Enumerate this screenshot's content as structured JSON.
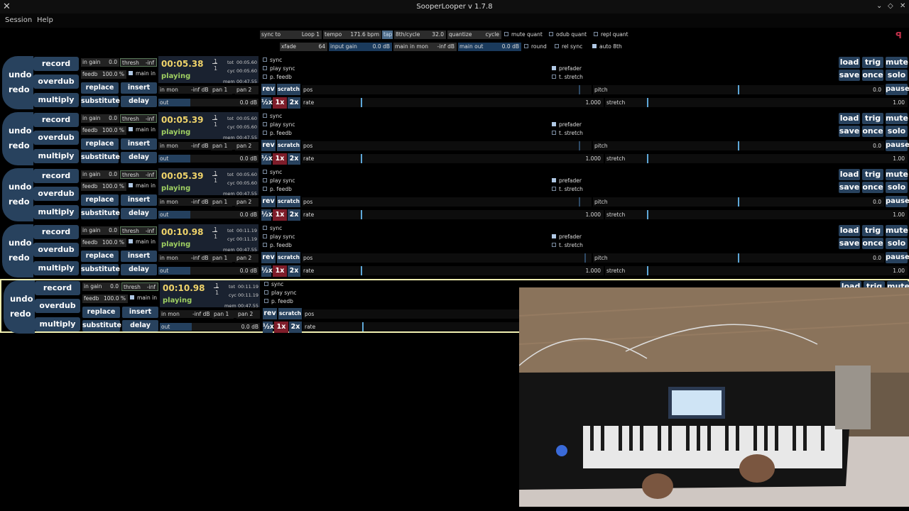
{
  "window": {
    "title": "SooperLooper v 1.7.8"
  },
  "menu": {
    "session": "Session",
    "help": "Help"
  },
  "globals": {
    "sync_to_label": "sync to",
    "sync_to_value": "Loop 1",
    "tempo_label": "tempo",
    "tempo_value": "171.6 bpm",
    "tap": "tap",
    "eighth_label": "8th/cycle",
    "eighth_value": "32.0",
    "quantize_label": "quantize",
    "quantize_value": "cycle",
    "mute_quant": "mute quant",
    "odub_quant": "odub quant",
    "repl_quant": "repl quant",
    "xfade_label": "xfade",
    "xfade_value": "64",
    "input_gain_label": "input gain",
    "input_gain_value": "0.0 dB",
    "main_in_mon_label": "main in mon",
    "main_in_mon_value": "-inf dB",
    "main_out_label": "main out",
    "main_out_value": "0.0 dB",
    "round": "round",
    "rel_sync": "rel sync",
    "auto_8th": "auto 8th"
  },
  "labels": {
    "undo": "undo",
    "redo": "redo",
    "record": "record",
    "overdub": "overdub",
    "multiply": "multiply",
    "replace": "replace",
    "insert": "insert",
    "substitute": "substitute",
    "delay": "delay",
    "in_gain": "in gain",
    "thresh": "thresh",
    "feedb": "feedb",
    "main_in": "main in",
    "in_mon": "in mon",
    "pan1": "pan 1",
    "pan2": "pan 2",
    "out": "out",
    "tot": "tot",
    "cyc": "cyc",
    "mem": "mem",
    "sync": "sync",
    "play_sync": "play sync",
    "p_feedb": "p. feedb",
    "prefader": "prefader",
    "t_stretch": "t. stretch",
    "rev": "rev",
    "scratch": "scratch",
    "pos": "pos",
    "rate": "rate",
    "half": "½x",
    "x1": "1x",
    "x2": "2x",
    "pitch": "pitch",
    "stretch": "stretch",
    "load": "load",
    "trig": "trig",
    "mute": "mute",
    "save": "save",
    "once": "once",
    "solo": "solo",
    "pause": "pause"
  },
  "loops": [
    {
      "time": "00:05.38",
      "state": "playing",
      "in_gain": "0.0",
      "thresh": "-inf",
      "feedb": "100.0 %",
      "in_mon": "-inf dB",
      "out": "0.0 dB",
      "tot": "00:05.60",
      "cyc": "00:05.60",
      "mem": "00:47.55",
      "cycle_num": "1",
      "cycle_den": "1",
      "rate": "1.000",
      "pitch": "0.0",
      "stretch": "1.00"
    },
    {
      "time": "00:05.39",
      "state": "playing",
      "in_gain": "0.0",
      "thresh": "-inf",
      "feedb": "100.0 %",
      "in_mon": "-inf dB",
      "out": "0.0 dB",
      "tot": "00:05.60",
      "cyc": "00:05.60",
      "mem": "00:47.55",
      "cycle_num": "1",
      "cycle_den": "1",
      "rate": "1.000",
      "pitch": "0.0",
      "stretch": "1.00"
    },
    {
      "time": "00:05.39",
      "state": "playing",
      "in_gain": "0.0",
      "thresh": "-inf",
      "feedb": "100.0 %",
      "in_mon": "-inf dB",
      "out": "0.0 dB",
      "tot": "00:05.60",
      "cyc": "00:05.60",
      "mem": "00:47.55",
      "cycle_num": "1",
      "cycle_den": "1",
      "rate": "1.000",
      "pitch": "0.0",
      "stretch": "1.00"
    },
    {
      "time": "00:10.98",
      "state": "playing",
      "in_gain": "0.0",
      "thresh": "-inf",
      "feedb": "100.0 %",
      "in_mon": "-inf dB",
      "out": "0.0 dB",
      "tot": "00:11.19",
      "cyc": "00:11.19",
      "mem": "00:47.55",
      "cycle_num": "1",
      "cycle_den": "1",
      "rate": "1.000",
      "pitch": "0.0",
      "stretch": "1.00"
    },
    {
      "time": "00:10.98",
      "state": "playing",
      "in_gain": "0.0",
      "thresh": "-inf",
      "feedb": "100.0 %",
      "in_mon": "-inf dB",
      "out": "0.0 dB",
      "tot": "00:11.19",
      "cyc": "00:11.19",
      "mem": "00:47.55",
      "cycle_num": "1",
      "cycle_den": "1"
    }
  ]
}
